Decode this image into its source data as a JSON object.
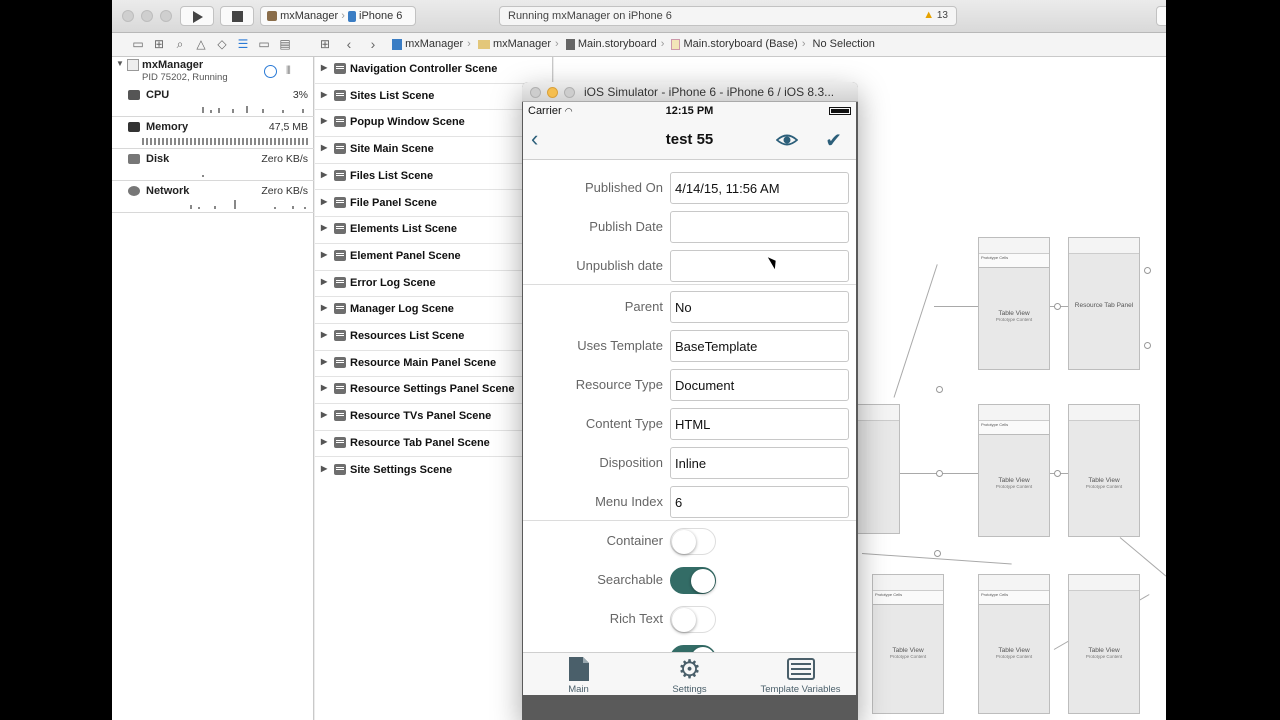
{
  "toolbar": {
    "scheme_app": "mxManager",
    "scheme_device": "iPhone 6",
    "activity_text": "Running mxManager on iPhone 6",
    "warning_count": "13"
  },
  "jumpbar": {
    "items": [
      "mxManager",
      "mxManager",
      "Main.storyboard",
      "Main.storyboard (Base)",
      "No Selection"
    ]
  },
  "debug_nav": {
    "process_name": "mxManager",
    "process_status": "PID 75202, Running",
    "gauges": [
      {
        "label": "CPU",
        "value": "3%"
      },
      {
        "label": "Memory",
        "value": "47,5 MB"
      },
      {
        "label": "Disk",
        "value": "Zero KB/s"
      },
      {
        "label": "Network",
        "value": "Zero KB/s"
      }
    ]
  },
  "scenes": [
    "Navigation Controller Scene",
    "Sites List Scene",
    "Popup Window Scene",
    "Site Main Scene",
    "Files List Scene",
    "File Panel Scene",
    "Elements List Scene",
    "Element Panel Scene",
    "Error Log Scene",
    "Manager Log Scene",
    "Resources List Scene",
    "Resource Main Panel Scene",
    "Resource Settings Panel Scene",
    "Resource TVs Panel Scene",
    "Resource Tab Panel Scene",
    "Site Settings Scene"
  ],
  "canvas": {
    "table_view": "Table View",
    "prototype_content": "Prototype Content",
    "resource_tab_panel": "Resource Tab Panel",
    "prototype_cells": "Prototype Cells"
  },
  "simulator": {
    "window_title": "iOS Simulator - iPhone 6 - iPhone 6 / iOS 8.3...",
    "carrier": "Carrier",
    "time": "12:15 PM",
    "nav_title": "test 55",
    "fields": [
      {
        "label": "Published On",
        "value": "4/14/15, 11:56 AM"
      },
      {
        "label": "Publish Date",
        "value": ""
      },
      {
        "label": "Unpublish date",
        "value": ""
      },
      {
        "label": "Parent",
        "value": "No"
      },
      {
        "label": "Uses Template",
        "value": "BaseTemplate"
      },
      {
        "label": "Resource Type",
        "value": "Document"
      },
      {
        "label": "Content Type",
        "value": "HTML"
      },
      {
        "label": "Disposition",
        "value": "Inline"
      },
      {
        "label": "Menu Index",
        "value": "6"
      }
    ],
    "toggles": [
      {
        "label": "Container",
        "on": false
      },
      {
        "label": "Searchable",
        "on": true
      },
      {
        "label": "Rich Text",
        "on": false
      }
    ],
    "tabs": [
      {
        "label": "Main",
        "icon": "document-icon"
      },
      {
        "label": "Settings",
        "icon": "gear-icon"
      },
      {
        "label": "Template Variables",
        "icon": "list-icon"
      }
    ],
    "accent_color": "#2c5f7a",
    "toggle_on_color": "#336c66"
  }
}
